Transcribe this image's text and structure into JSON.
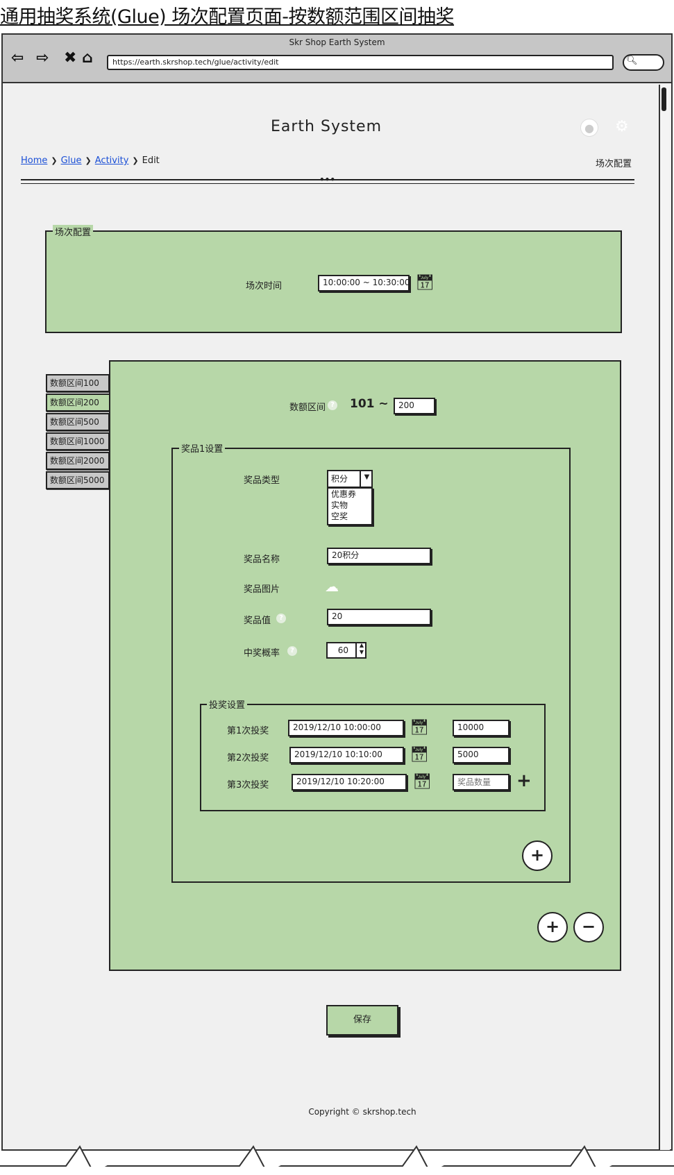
{
  "doc_title": "通用抽奖系统(Glue) 场次配置页面-按数额范围区间抽奖",
  "window": {
    "title": "Skr Shop Earth System",
    "url": "https://earth.skrshop.tech/glue/activity/edit"
  },
  "header": {
    "app_title": "Earth System",
    "breadcrumb": [
      "Home",
      "Glue",
      "Activity",
      "Edit"
    ],
    "page_label": "场次配置"
  },
  "session": {
    "legend": "场次配置",
    "time_label": "场次时间",
    "time_value": "10:00:00 ~ 10:30:00"
  },
  "range_tabs": [
    "数额区间100",
    "数额区间200",
    "数额区间500",
    "数额区间1000",
    "数额区间2000",
    "数额区间5000"
  ],
  "range": {
    "label": "数额区间",
    "from": "101 ~",
    "to_value": "200"
  },
  "prize": {
    "legend": "奖品1设置",
    "type_label": "奖品类型",
    "type_selected": "积分",
    "type_options": [
      "优惠券",
      "实物",
      "空奖"
    ],
    "name_label": "奖品名称",
    "name_value": "20积分",
    "image_label": "奖品图片",
    "value_label": "奖品值",
    "value_value": "20",
    "prob_label": "中奖概率",
    "prob_value": "60"
  },
  "draw": {
    "legend": "投奖设置",
    "rows": [
      {
        "label": "第1次投奖",
        "time": "2019/12/10 10:00:00",
        "qty": "10000"
      },
      {
        "label": "第2次投奖",
        "time": "2019/12/10 10:10:00",
        "qty": "5000"
      },
      {
        "label": "第3次投奖",
        "time": "2019/12/10 10:20:00",
        "qty": ""
      }
    ],
    "qty_placeholder": "奖品数量"
  },
  "save_label": "保存",
  "copyright": "Copyright © skrshop.tech",
  "icons": [
    "back-icon",
    "forward-icon",
    "close-icon",
    "home-icon",
    "search-icon",
    "user-icon",
    "gear-icon",
    "calendar-icon",
    "help-icon",
    "upload-icon",
    "plus-icon",
    "minus-icon"
  ],
  "colors": {
    "panel": "#b7d7a8",
    "link": "#1a4fd6",
    "chrome": "#c6c6c6"
  }
}
